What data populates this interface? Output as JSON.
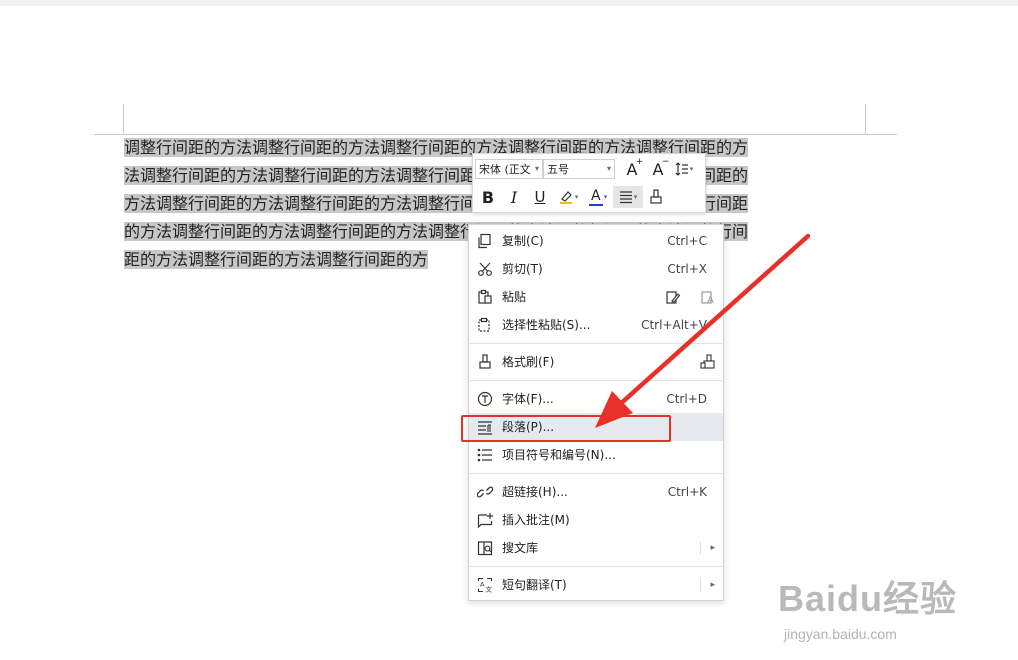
{
  "document": {
    "lines": [
      "调整行间距的方法调整行间距的方法调整行间距的方法调整行间距的方法调整行间距的方",
      "法调整行间距的方法调整行间距的方法调整行间距的方法调整行间距的方法调整行间距的",
      "方法调整行间距的方法调整行间距的方法调整行间距的方法调整行间距的方法调整行间距",
      "的方法调整行间距的方法调整行间距的方法调整行间距的方法调整行间距的方法调整行间",
      "距的方法调整行间距的方法调整行间距的方"
    ]
  },
  "mini_toolbar": {
    "font_name": "宋体 (正文",
    "font_size": "五号",
    "bold_label": "B",
    "italic_label": "I",
    "underline_label": "U",
    "font_color_label": "A",
    "font_color": "#1f3fd0",
    "highlight_color": "#f2c200",
    "grow_label": "A",
    "shrink_label": "A"
  },
  "context_menu": {
    "items": [
      {
        "label": "复制(C)",
        "shortcut": "Ctrl+C",
        "icon": "copy-icon"
      },
      {
        "label": "剪切(T)",
        "shortcut": "Ctrl+X",
        "icon": "scissors-icon"
      },
      {
        "label": "粘贴",
        "icon": "paste-icon"
      },
      {
        "label": "选择性粘贴(S)...",
        "shortcut": "Ctrl+Alt+V",
        "icon": "paste-special-icon"
      },
      {
        "label": "格式刷(F)",
        "icon": "format-painter-icon"
      },
      {
        "label": "字体(F)...",
        "shortcut": "Ctrl+D",
        "icon": "font-icon"
      },
      {
        "label": "段落(P)...",
        "icon": "paragraph-icon"
      },
      {
        "label": "项目符号和编号(N)...",
        "icon": "bullets-icon"
      },
      {
        "label": "超链接(H)...",
        "shortcut": "Ctrl+K",
        "icon": "link-icon"
      },
      {
        "label": "插入批注(M)",
        "icon": "comment-icon"
      },
      {
        "label": "搜文库",
        "icon": "library-search-icon"
      },
      {
        "label": "短句翻译(T)",
        "icon": "translate-icon"
      }
    ],
    "submenu_arrow": "▸"
  },
  "annotation": {
    "color": "#e8302a"
  },
  "watermark": {
    "brand": "Baidu经验",
    "url": "jingyan.baidu.com"
  }
}
